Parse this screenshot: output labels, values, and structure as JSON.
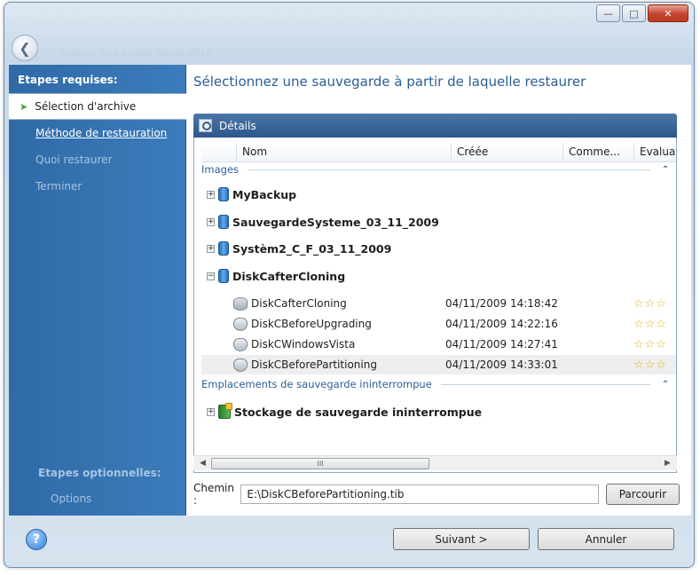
{
  "window": {
    "faint_title": "Acronis True Image Home 2010",
    "controls": [
      "minimize-icon",
      "maximize-icon",
      "close-icon"
    ]
  },
  "sidebar": {
    "required_heading": "Etapes requises:",
    "items": [
      {
        "label": "Sélection d'archive",
        "state": "active"
      },
      {
        "label": "Méthode de restauration",
        "state": "link"
      },
      {
        "label": "Quoi restaurer",
        "state": "disabled"
      },
      {
        "label": "Terminer",
        "state": "disabled"
      }
    ],
    "optional_heading": "Etapes optionnelles:",
    "optional_items": [
      "Options"
    ]
  },
  "main": {
    "title": "Sélectionnez une sauvegarde à partir de laquelle restaurer",
    "details_label": "Détails",
    "columns": [
      "Nom",
      "Créée",
      "Comme...",
      "Evaluat"
    ],
    "groups": {
      "images": "Images",
      "continuous": "Emplacements de sauvegarde ininterrompue"
    },
    "archives": [
      {
        "name": "MyBackup",
        "expander": "+"
      },
      {
        "name": "SauvegardeSysteme_03_11_2009",
        "expander": "+"
      },
      {
        "name": "Systèm2_C_F_03_11_2009",
        "expander": "+"
      },
      {
        "name": "DiskCafterCloning",
        "expander": "−"
      }
    ],
    "versions": [
      {
        "name": "DiskCafterCloning",
        "date": "04/11/2009 14:18:42",
        "stars": "☆☆☆"
      },
      {
        "name": "DiskCBeforeUpgrading",
        "date": "04/11/2009 14:22:16",
        "stars": "☆☆☆"
      },
      {
        "name": "DiskCWindowsVista",
        "date": "04/11/2009 14:27:41",
        "stars": "☆☆☆"
      },
      {
        "name": "DiskCBeforePartitioning",
        "date": "04/11/2009 14:33:01",
        "stars": "☆☆☆"
      }
    ],
    "continuous_item": {
      "name": "Stockage de sauvegarde ininterrompue",
      "expander": "+"
    },
    "scroll_thumb": "III",
    "path_label": "Chemin :",
    "path_value": "E:\\DiskCBeforePartitioning.tib",
    "browse_label": "Parcourir"
  },
  "footer": {
    "next_label": "Suivant >",
    "cancel_label": "Annuler"
  },
  "colors": {
    "sidebar": "#3573b1",
    "title_blue": "#2a5f95",
    "details_bar": "#3a6599",
    "star": "#e6b21e"
  }
}
